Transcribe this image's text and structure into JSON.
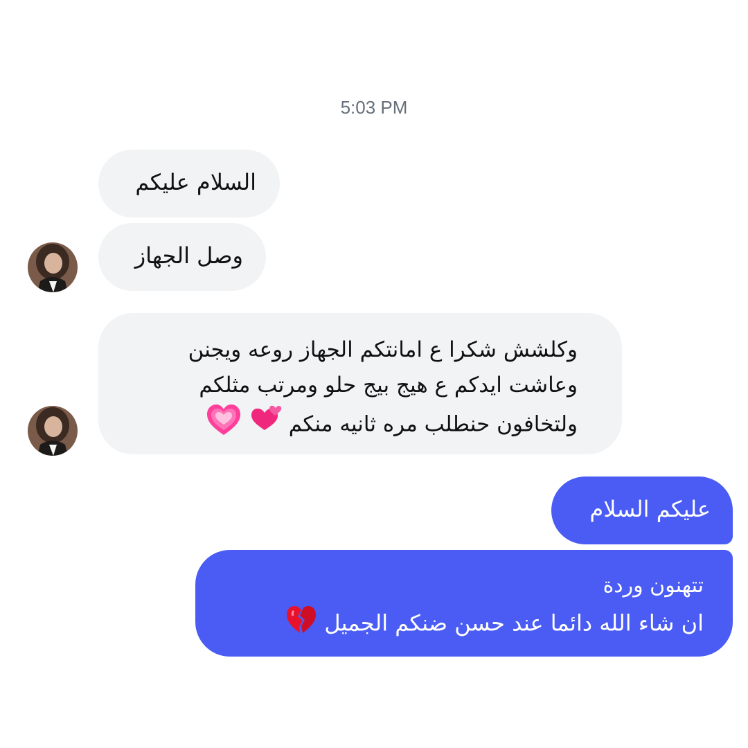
{
  "chat": {
    "timestamp": "5:03 PM",
    "incoming": [
      {
        "text": "السلام عليكم"
      },
      {
        "text": "وصل الجهاز"
      },
      {
        "lines": [
          "وكلشش شكرا ع امانتكم الجهاز روعه ويجنن",
          "وعاشت ايدكم ع هيج بيج حلو ومرتب مثلكم",
          "ولتخافون حنطلب مره ثانيه منكم"
        ],
        "emojis": [
          "two-hearts",
          "growing-heart"
        ]
      }
    ],
    "outgoing": [
      {
        "text": "عليكم السلام"
      },
      {
        "lines": [
          "تتهنون وردة",
          "ان شاء الله دائما عند حسن ضنكم الجميل"
        ],
        "emojis": [
          "broken-heart"
        ]
      }
    ]
  },
  "colors": {
    "outgoing_bubble": "#4a5cf3",
    "incoming_bubble": "#f2f3f5",
    "timestamp_text": "#66707a"
  }
}
